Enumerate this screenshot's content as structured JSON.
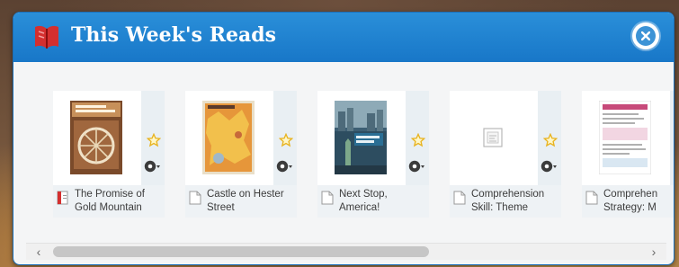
{
  "dialog": {
    "title": "This Week's Reads",
    "close_label": "Close"
  },
  "items": [
    {
      "label": "The Promise of\nGold Mountain",
      "thumbnail": "book-cover-gold-mountain",
      "favorite": "star-outline",
      "actions": "gear-menu"
    },
    {
      "label": "Castle on Hester\nStreet",
      "thumbnail": "book-cover-castle-hester-street",
      "favorite": "star-outline",
      "actions": "gear-menu"
    },
    {
      "label": "Next Stop,\nAmerica!",
      "thumbnail": "book-cover-next-stop-america",
      "favorite": "star-outline",
      "actions": "gear-menu"
    },
    {
      "label": "Comprehension\nSkill: Theme",
      "thumbnail": "document-placeholder",
      "favorite": "star-outline",
      "actions": "gear-menu"
    },
    {
      "label": "Comprehen\nStrategy: M",
      "thumbnail": "worksheet-page",
      "favorite": "star-outline",
      "actions": "gear-menu"
    }
  ],
  "scroll": {
    "left_arrow": "‹",
    "right_arrow": "›"
  },
  "colors": {
    "header": "#1f84d2",
    "tile_bg": "#e9eff3",
    "star": "#e8b320",
    "text": "#3c3c3c"
  }
}
